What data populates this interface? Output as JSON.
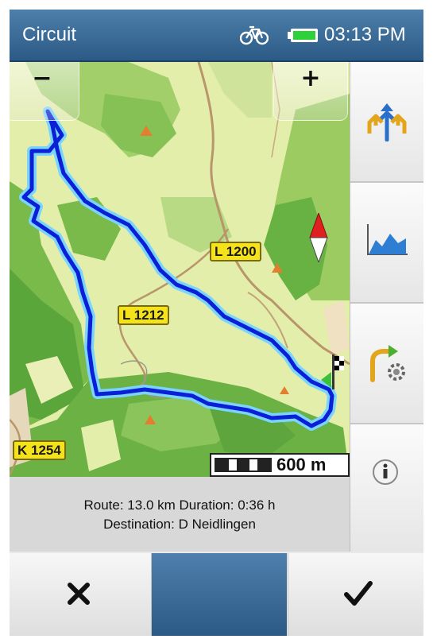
{
  "statusbar": {
    "title": "Circuit",
    "time": "03:13 PM",
    "profile_icon": "bicycle-icon",
    "battery_icon": "battery-full-icon",
    "battery_color": "#2fd13a"
  },
  "map": {
    "zoom_out_label": "−",
    "zoom_in_label": "+",
    "road_labels": {
      "l1200": "L 1200",
      "l1212": "L 1212",
      "k1254": "K 1254"
    },
    "scale_label": "600 m",
    "route_color": "#0a1fd6",
    "route_glow_color": "#7ad4ff",
    "compass_icon": "compass-icon",
    "destination_icon": "finish-flag-icon"
  },
  "route_info": {
    "summary": "Route: 13.0 km Duration: 0:36 h",
    "destination": "Destination: D Neidlingen"
  },
  "sidebar": {
    "buttons": [
      {
        "name": "route-options",
        "icon": "route-arrows-icon"
      },
      {
        "name": "elevation-profile",
        "icon": "elevation-profile-icon"
      },
      {
        "name": "route-settings",
        "icon": "route-settings-icon"
      },
      {
        "name": "info",
        "icon": "info-icon"
      }
    ]
  },
  "bottombar": {
    "cancel_icon": "close-icon",
    "confirm_icon": "checkmark-icon",
    "accent_color": "#2c5a86"
  }
}
